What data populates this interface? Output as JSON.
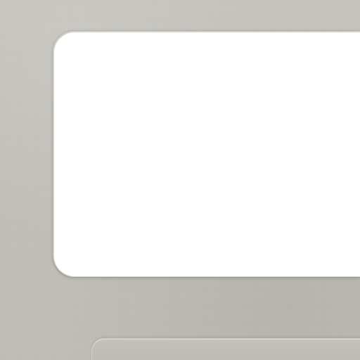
{
  "theme": {
    "background_color": "#c2c0b9",
    "panel_color": "#ffffff",
    "ledge_color": "#bfbdb6"
  },
  "elements": {
    "background": "light-grey-surface",
    "panel": "white-rounded-panel",
    "bottom": "rounded-ledge"
  }
}
